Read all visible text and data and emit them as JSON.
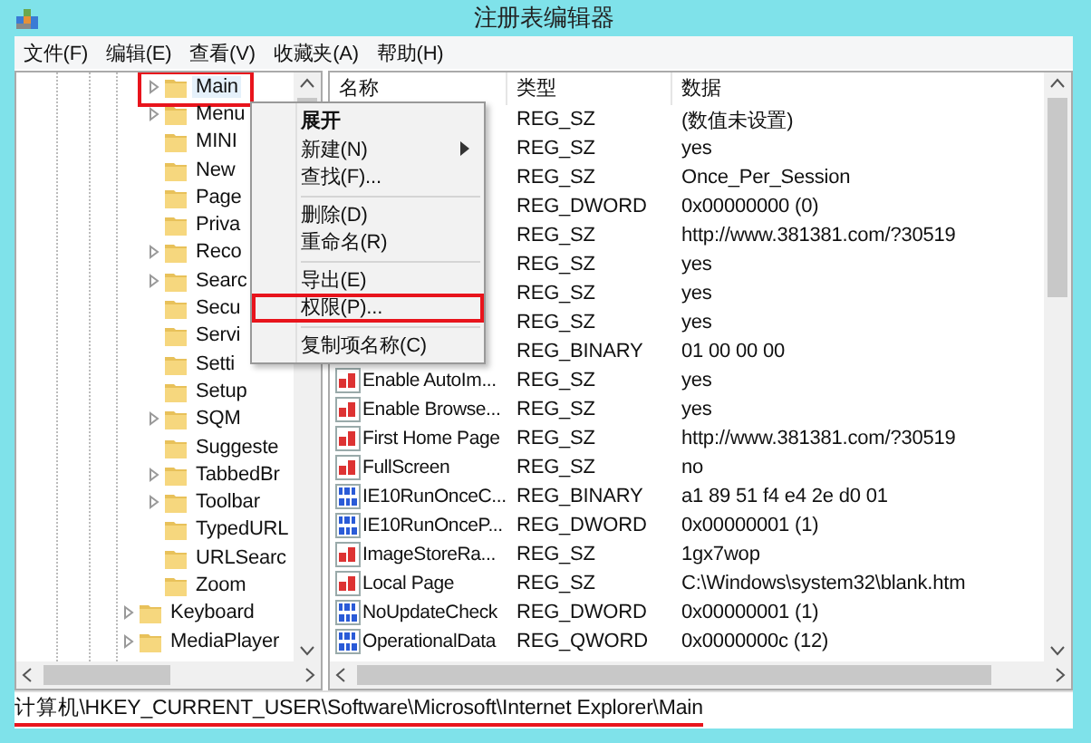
{
  "window": {
    "title": "注册表编辑器"
  },
  "menu_bar": [
    "文件(F)",
    "编辑(E)",
    "查看(V)",
    "收藏夹(A)",
    "帮助(H)"
  ],
  "tree": {
    "items": [
      {
        "children": [
          {
            "label": "Main",
            "expandable": true,
            "selected": true,
            "highlighted": true
          },
          {
            "label": "Menu",
            "expandable": true,
            "selected": false,
            "highlighted": false
          },
          {
            "label": "MINI",
            "expandable": false,
            "selected": false,
            "highlighted": false
          },
          {
            "label": "New",
            "expandable": false,
            "selected": false,
            "highlighted": false
          },
          {
            "label": "Page",
            "expandable": false,
            "selected": false,
            "highlighted": false
          },
          {
            "label": "Priva",
            "expandable": false,
            "selected": false,
            "highlighted": false
          },
          {
            "label": "Reco",
            "expandable": true,
            "selected": false,
            "highlighted": false
          },
          {
            "label": "Searc",
            "expandable": true,
            "selected": false,
            "highlighted": false
          },
          {
            "label": "Secu",
            "expandable": false,
            "selected": false,
            "highlighted": false
          },
          {
            "label": "Servi",
            "expandable": false,
            "selected": false,
            "highlighted": false
          },
          {
            "label": "Setti",
            "expandable": false,
            "selected": false,
            "highlighted": false
          },
          {
            "label": "Setup",
            "expandable": false,
            "selected": false,
            "highlighted": false
          },
          {
            "label": "SQM",
            "expandable": true,
            "selected": false,
            "highlighted": false
          },
          {
            "label": "Suggeste",
            "expandable": false,
            "selected": false,
            "highlighted": false
          },
          {
            "label": "TabbedBr",
            "expandable": true,
            "selected": false,
            "highlighted": false
          },
          {
            "label": "Toolbar",
            "expandable": true,
            "selected": false,
            "highlighted": false
          },
          {
            "label": "TypedURL",
            "expandable": false,
            "selected": false,
            "highlighted": false
          },
          {
            "label": "URLSearc",
            "expandable": false,
            "selected": false,
            "highlighted": false
          },
          {
            "label": "Zoom",
            "expandable": false,
            "selected": false,
            "highlighted": false
          }
        ]
      },
      {
        "label": "Keyboard",
        "expandable": true,
        "selected": false,
        "highlighted": false
      },
      {
        "label": "MediaPlayer",
        "expandable": true,
        "selected": false,
        "highlighted": false
      }
    ]
  },
  "table": {
    "columns": [
      "名称",
      "类型",
      "数据"
    ],
    "rows": [
      {
        "type": "REG_SZ",
        "data": "(数值未设置)"
      },
      {
        "type": "REG_SZ",
        "data": "yes"
      },
      {
        "type": "REG_SZ",
        "data": "Once_Per_Session"
      },
      {
        "type": "REG_DWORD",
        "data": "0x00000000 (0)"
      },
      {
        "type": "REG_SZ",
        "data": "http://www.381381.com/?30519"
      },
      {
        "type": "REG_SZ",
        "data": "yes"
      },
      {
        "type": "REG_SZ",
        "data": "yes"
      },
      {
        "type": "REG_SZ",
        "data": "yes"
      },
      {
        "type": "REG_BINARY",
        "data": "01 00 00 00"
      },
      {
        "kind": "string",
        "name": "Enable AutoIm...",
        "type": "REG_SZ",
        "data": "yes"
      },
      {
        "kind": "string",
        "name": "Enable Browse...",
        "type": "REG_SZ",
        "data": "yes"
      },
      {
        "kind": "string",
        "name": "First Home Page",
        "type": "REG_SZ",
        "data": "http://www.381381.com/?30519"
      },
      {
        "kind": "string",
        "name": "FullScreen",
        "type": "REG_SZ",
        "data": "no"
      },
      {
        "kind": "binary",
        "name": "IE10RunOnceC...",
        "type": "REG_BINARY",
        "data": "a1 89 51 f4 e4 2e d0 01"
      },
      {
        "kind": "binary",
        "name": "IE10RunOnceP...",
        "type": "REG_DWORD",
        "data": "0x00000001 (1)"
      },
      {
        "kind": "string",
        "name": "ImageStoreRa...",
        "type": "REG_SZ",
        "data": "1gx7wop"
      },
      {
        "kind": "string",
        "name": "Local Page",
        "type": "REG_SZ",
        "data": "C:\\Windows\\system32\\blank.htm"
      },
      {
        "kind": "binary",
        "name": "NoUpdateCheck",
        "type": "REG_DWORD",
        "data": "0x00000001 (1)"
      },
      {
        "kind": "binary",
        "name": "OperationalData",
        "type": "REG_QWORD",
        "data": "0x0000000c (12)"
      }
    ]
  },
  "context_menu": {
    "items": [
      {
        "kind": "item",
        "label": "展开",
        "bold": true,
        "submenu": false,
        "highlighted": false
      },
      {
        "kind": "item",
        "label": "新建(N)",
        "bold": false,
        "submenu": true,
        "highlighted": false
      },
      {
        "kind": "item",
        "label": "查找(F)...",
        "bold": false,
        "submenu": false,
        "highlighted": false
      },
      {
        "kind": "separator"
      },
      {
        "kind": "item",
        "label": "删除(D)",
        "bold": false,
        "submenu": false,
        "highlighted": false
      },
      {
        "kind": "item",
        "label": "重命名(R)",
        "bold": false,
        "submenu": false,
        "highlighted": false
      },
      {
        "kind": "separator"
      },
      {
        "kind": "item",
        "label": "导出(E)",
        "bold": false,
        "submenu": false,
        "highlighted": false
      },
      {
        "kind": "item",
        "label": "权限(P)...",
        "bold": false,
        "submenu": false,
        "highlighted": true
      },
      {
        "kind": "separator"
      },
      {
        "kind": "item",
        "label": "复制项名称(C)",
        "bold": false,
        "submenu": false,
        "highlighted": false
      }
    ]
  },
  "status_bar": {
    "path": "计算机\\HKEY_CURRENT_USER\\Software\\Microsoft\\Internet Explorer\\Main",
    "underlined": true
  }
}
